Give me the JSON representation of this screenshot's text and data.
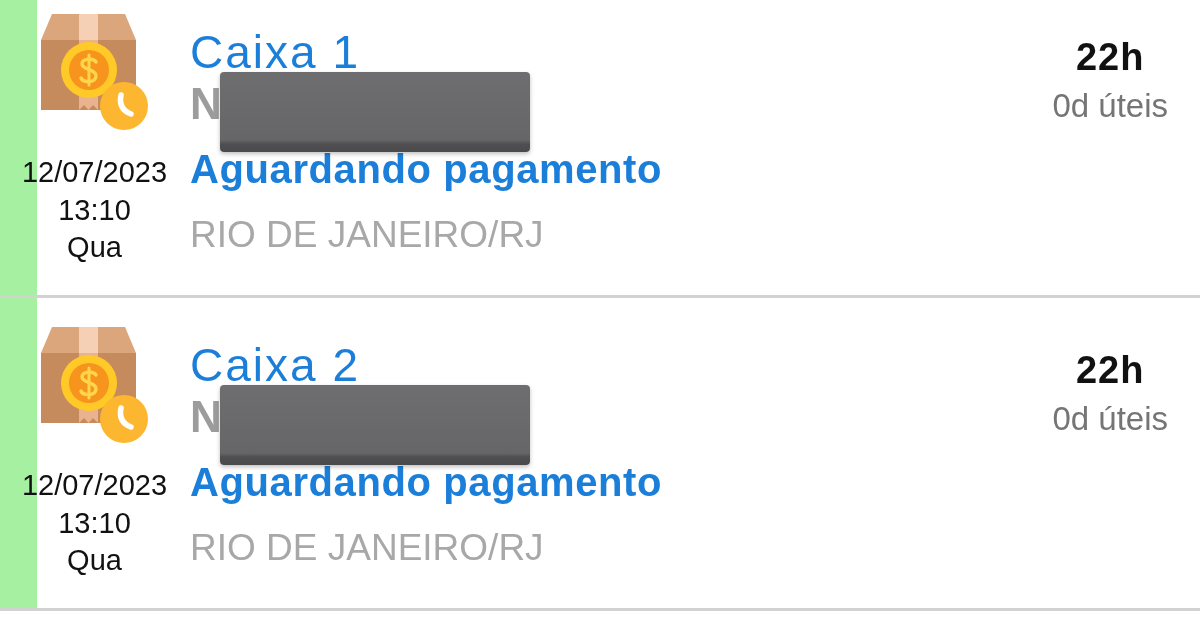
{
  "items": [
    {
      "title": "Caixa 1",
      "name": {
        "text": "N",
        "redacted": true
      },
      "status": "Aguardando pagamento",
      "location": "RIO DE JANEIRO/RJ",
      "date": "12/07/2023",
      "time": "13:10",
      "weekday": "Qua",
      "elapsed": "22h",
      "business_days": "0d úteis"
    },
    {
      "title": "Caixa 2",
      "name": {
        "text": "N",
        "redacted": true
      },
      "status": "Aguardando pagamento",
      "location": "RIO DE JANEIRO/RJ",
      "date": "12/07/2023",
      "time": "13:10",
      "weekday": "Qua",
      "elapsed": "22h",
      "business_days": "0d úteis"
    }
  ]
}
